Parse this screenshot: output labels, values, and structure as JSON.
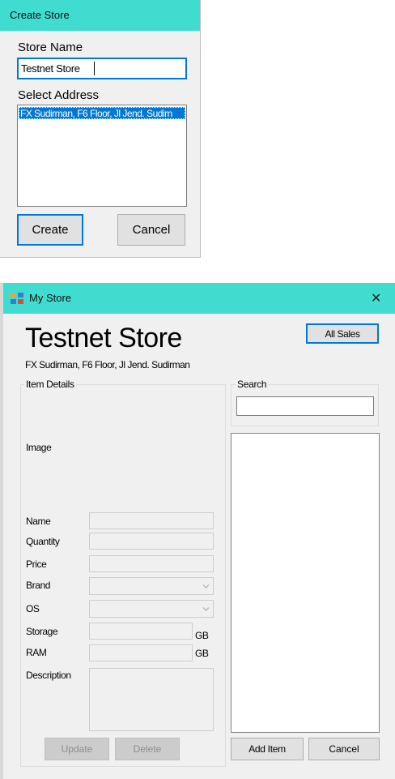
{
  "create_store": {
    "title": "Create Store",
    "store_name_label": "Store Name",
    "store_name_value": "Testnet Store",
    "select_address_label": "Select Address",
    "addresses": [
      "FX Sudirman, F6 Floor, Jl Jend. Sudirn"
    ],
    "create_label": "Create",
    "cancel_label": "Cancel"
  },
  "my_store": {
    "title": "My Store",
    "close_glyph": "✕",
    "app_icon": "app-window-icon",
    "store_title": "Testnet Store",
    "store_address": "FX Sudirman, F6 Floor, Jl Jend. Sudirman",
    "all_sales_label": "All Sales",
    "item_details_label": "Item Details",
    "image_label": "Image",
    "fields": {
      "name": "Name",
      "quantity": "Quantity",
      "price": "Price",
      "brand": "Brand",
      "os": "OS",
      "storage": "Storage",
      "ram": "RAM",
      "description": "Description"
    },
    "unit_gb": "GB",
    "update_label": "Update",
    "delete_label": "Delete",
    "search_label": "Search",
    "search_value": "",
    "add_item_label": "Add Item",
    "cancel_label": "Cancel"
  },
  "colors": {
    "titlebar": "#40dcd0",
    "selection": "#0078d7",
    "window_bg": "#f0f0f0"
  }
}
